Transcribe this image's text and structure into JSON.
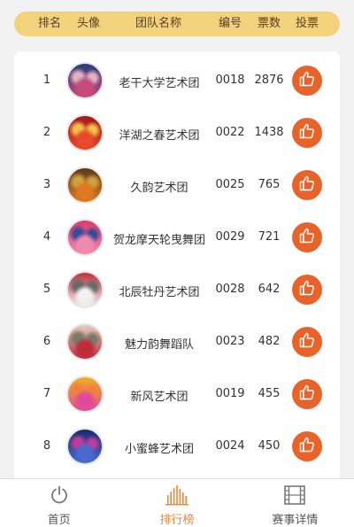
{
  "header": {
    "rank": "排名",
    "avatar": "头像",
    "team_name": "团队名称",
    "code": "编号",
    "votes": "票数",
    "vote": "投票"
  },
  "rows": [
    {
      "rank": "1",
      "team": "老干大学艺术团",
      "code": "0018",
      "votes": "2876",
      "avatar_colors": [
        "#2a3a7a",
        "#c84a7a",
        "#e0b0c0"
      ]
    },
    {
      "rank": "2",
      "team": "洋湖之春艺术团",
      "code": "0022",
      "votes": "1438",
      "avatar_colors": [
        "#a31818",
        "#e84a2a",
        "#f2c04a"
      ]
    },
    {
      "rank": "3",
      "team": "久韵艺术团",
      "code": "0025",
      "votes": "765",
      "avatar_colors": [
        "#5a3a1a",
        "#e07a20",
        "#d0a040"
      ]
    },
    {
      "rank": "4",
      "team": "贺龙摩天轮曳舞团",
      "code": "0029",
      "votes": "721",
      "avatar_colors": [
        "#d93a6a",
        "#f08ab0",
        "#3a4a9a"
      ]
    },
    {
      "rank": "5",
      "team": "北辰牡丹艺术团",
      "code": "0028",
      "votes": "642",
      "avatar_colors": [
        "#c0303a",
        "#f0f0f0",
        "#6a6a6a"
      ]
    },
    {
      "rank": "6",
      "team": "魅力韵舞蹈队",
      "code": "0023",
      "votes": "482",
      "avatar_colors": [
        "#e0d0c0",
        "#c02a3a",
        "#7a7a6a"
      ]
    },
    {
      "rank": "7",
      "team": "新风艺术团",
      "code": "0019",
      "votes": "455",
      "avatar_colors": [
        "#f0b020",
        "#e04a9a",
        "#f08040"
      ]
    },
    {
      "rank": "8",
      "team": "小蜜蜂艺术团",
      "code": "0024",
      "votes": "450",
      "avatar_colors": [
        "#1a2a6a",
        "#4a6ad0",
        "#c03a9a"
      ]
    }
  ],
  "tabs": [
    {
      "label": "首页",
      "icon": "power-icon",
      "active": false
    },
    {
      "label": "排行榜",
      "icon": "ranking-bars-icon",
      "active": true
    },
    {
      "label": "赛事详情",
      "icon": "film-icon",
      "active": false
    }
  ],
  "colors": {
    "header_bg": "#f3d27c",
    "vote_button": "#e8632a",
    "active_tab": "#e58a3b"
  }
}
